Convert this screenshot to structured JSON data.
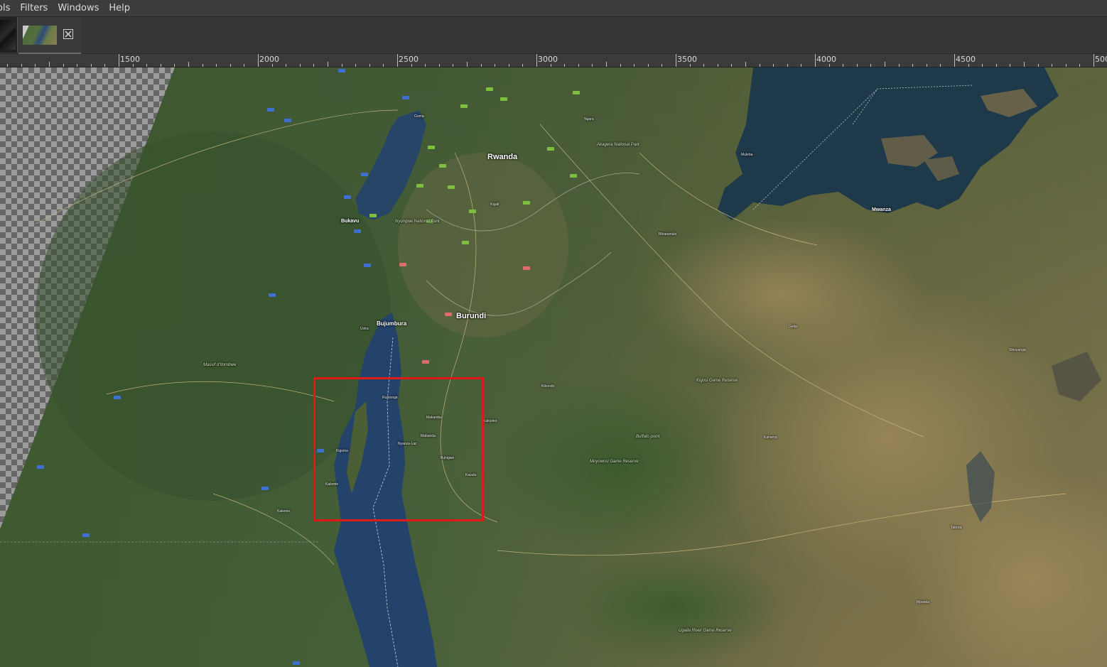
{
  "menubar": {
    "items": [
      "ols",
      "Filters",
      "Windows",
      "Help"
    ]
  },
  "tabs": [
    {
      "name": "image-tab-1"
    },
    {
      "name": "image-tab-2",
      "close_icon": "close-x-icon"
    }
  ],
  "ruler": {
    "labels": [
      "1500",
      "2000",
      "2500",
      "3000",
      "3500",
      "4000",
      "4500",
      "500"
    ]
  },
  "map": {
    "countries": [
      "Rwanda",
      "Burundi"
    ],
    "capitals": [
      "Bujumbura",
      "Bukavu",
      "Mwanza"
    ],
    "parks": [
      "Nyungwe National Park",
      "Akagera National Park",
      "Kigosi Game Reserve",
      "Moyowosi Game Reserve",
      "Buffalo point",
      "Ugalla River Game Reserve",
      "Massif d'Itombwe"
    ],
    "towns": [
      "Goma",
      "Kigali",
      "Rumonge",
      "Nyanza-Lac",
      "Makamba",
      "Kasulu",
      "Kigoma",
      "Uvira",
      "Kalemie",
      "Kibondo",
      "Ngara",
      "Biharamulo",
      "Muleba",
      "Kahama",
      "Kakonko",
      "Buhigwe",
      "Mpanda",
      "Tabora",
      "Shinyanga",
      "Geita",
      "Kalemie",
      "Mabanda"
    ],
    "colors": {
      "selection_border": "#e01818",
      "transparency_light": "#9c9c9c",
      "transparency_dark": "#666666"
    }
  }
}
